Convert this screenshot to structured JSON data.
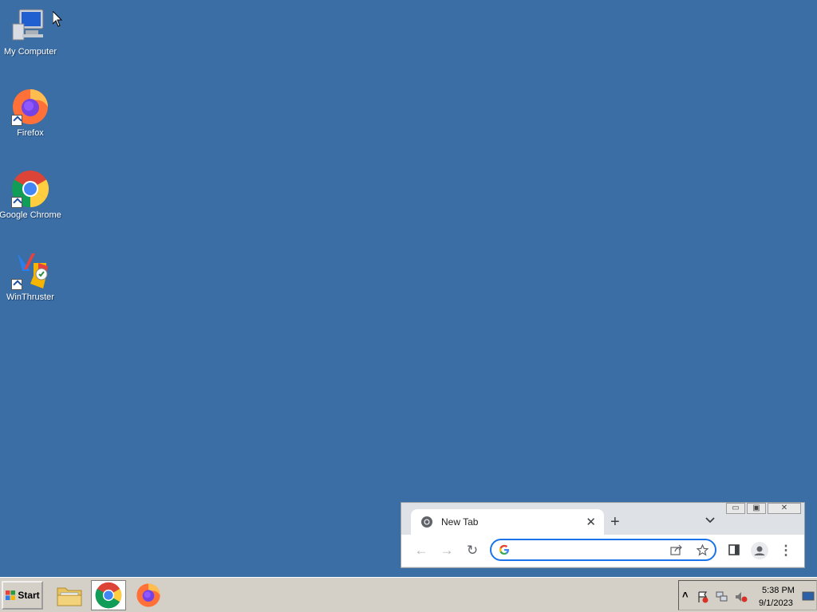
{
  "desktop": {
    "icons": [
      {
        "label": "My Computer",
        "icon": "my-computer-icon"
      },
      {
        "label": "Firefox",
        "icon": "firefox-icon"
      },
      {
        "label": "Google Chrome",
        "icon": "chrome-icon"
      },
      {
        "label": "WinThruster",
        "icon": "winthruster-icon"
      }
    ]
  },
  "chrome": {
    "tab_title": "New Tab",
    "tab_close": "✕",
    "new_tab": "+",
    "omnibox_value": "",
    "omnibox_placeholder": "",
    "back": "←",
    "forward": "→",
    "reload": "↻",
    "menu": "⋮",
    "accent": "#1a73e8"
  },
  "window_controls": {
    "minimize": "▭",
    "restore": "▣",
    "close": "✕"
  },
  "taskbar": {
    "start_label": "Start",
    "apps": [
      "file-explorer-icon",
      "chrome-icon",
      "firefox-icon"
    ],
    "active_app": "chrome-icon",
    "tray": {
      "expand": "˄",
      "time": "5:38 PM",
      "date": "9/1/2023"
    }
  },
  "colors": {
    "desktop_bg": "#3a6ea5",
    "taskbar_bg": "#d4d0c8"
  }
}
